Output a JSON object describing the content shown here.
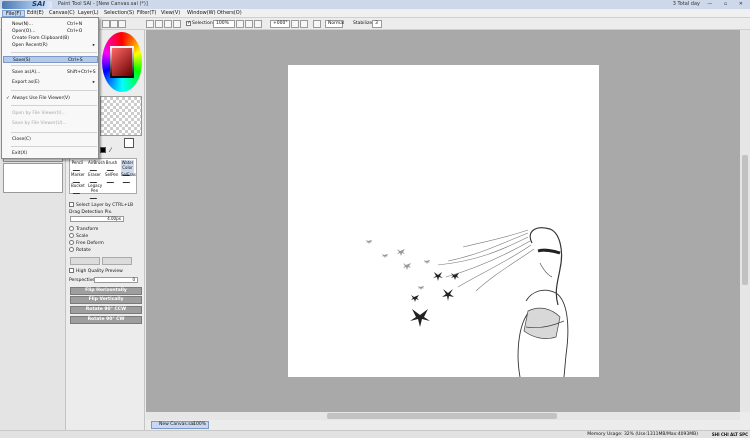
{
  "window": {
    "title": "Paint Tool SAI - [New Canvas.sai (*)]",
    "total_day": "3 Total day",
    "controls": "— ▫ ✕",
    "logo_text": "SAI"
  },
  "menubar": {
    "items": [
      "File(F)",
      "Edit(E)",
      "Canvas(C)",
      "Layer(L)",
      "Selection(S)",
      "Filter(T)",
      "View(V)",
      "Window(W)",
      "Others(O)"
    ]
  },
  "toolbar": {
    "selection_label": "Selection",
    "zoom": "100%",
    "rotation": "+000°",
    "blend_mode": "Normal",
    "stabilizer_label": "Stabilizer",
    "stabilizer_value": "3"
  },
  "file_menu": {
    "items": [
      {
        "label": "New(N)...",
        "shortcut": "Ctrl+N",
        "state": "normal"
      },
      {
        "label": "Open(O)...",
        "shortcut": "Ctrl+O",
        "state": "normal"
      },
      {
        "label": "Create From Clipboard(B)",
        "shortcut": "",
        "state": "normal"
      },
      {
        "label": "Open Recent(R)",
        "shortcut": "",
        "state": "normal",
        "submenu": true
      },
      {
        "label": "Save(S)",
        "shortcut": "Ctrl+S",
        "state": "highlighted"
      },
      {
        "label": "Save as(A)...",
        "shortcut": "Shift+Ctrl+S",
        "state": "normal"
      },
      {
        "label": "Export as(E)",
        "shortcut": "",
        "state": "normal",
        "submenu": true
      },
      {
        "label": "Always Use File Viewer(V)",
        "shortcut": "",
        "state": "checked"
      },
      {
        "label": "Open by File Viewer(I)...",
        "shortcut": "",
        "state": "disabled"
      },
      {
        "label": "Save by File Viewer(U)...",
        "shortcut": "",
        "state": "disabled"
      },
      {
        "label": "Close(C)",
        "shortcut": "",
        "state": "normal"
      },
      {
        "label": "Exit(X)",
        "shortcut": "",
        "state": "normal"
      }
    ]
  },
  "navigator": {
    "preview_zoom": "100%"
  },
  "tools": {
    "items": [
      "Pencil",
      "AirBrush",
      "Brush",
      "Water Color",
      "Marker",
      "Eraser",
      "SelPen",
      "SelEras",
      "Bucket",
      "Legacy Pen"
    ],
    "selected": "Water Color"
  },
  "tool_options": {
    "select_layer_ctrl_lb": "Select Layer by CTRL+LB",
    "drag_detection_label": "Drag Detection Pix.",
    "drag_detection_value": "4.00px",
    "transform_modes": [
      "Transform",
      "Scale",
      "Free Deform",
      "Rotate"
    ],
    "high_quality_preview": "High Quality Preview",
    "perspective_label": "Perspective",
    "perspective_value": "0",
    "buttons": [
      "Flip Horizontally",
      "Flip Vertically",
      "Rotate 90° CCW",
      "Rotate 90° CW"
    ]
  },
  "document_tab": {
    "name": "New Canvas.sai",
    "zoom": "100%"
  },
  "status": {
    "memory": "Memory Usage: 32% (Use:1311MB/Max:4093MB)",
    "keys": "SHI CHI ALT SPC"
  },
  "colors": {
    "workspace_bg": "#a9a9a9",
    "canvas_bg": "#ffffff",
    "menu_highlight": "#b6c9e8",
    "tab_bg": "#c9d8f0"
  }
}
